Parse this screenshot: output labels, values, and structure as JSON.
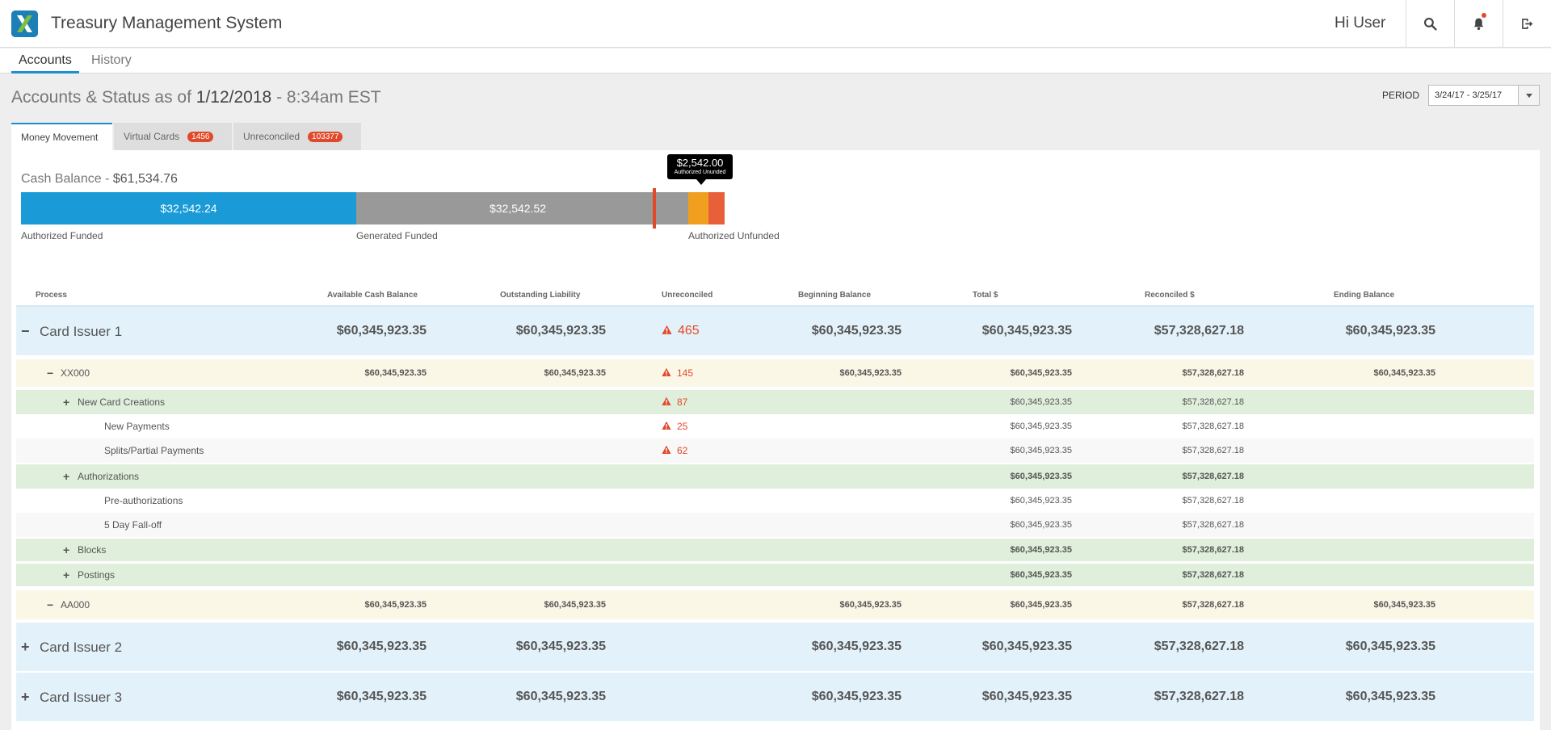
{
  "app": {
    "title": "Treasury Management System",
    "greeting": "Hi User"
  },
  "header_icons": [
    "search-icon",
    "bell-icon",
    "logout-icon"
  ],
  "page_tabs": [
    {
      "label": "Accounts",
      "active": true
    },
    {
      "label": "History",
      "active": false
    }
  ],
  "heading": {
    "prefix": "Accounts & Status as of ",
    "date": "1/12/2018",
    "suffix": " - 8:34am EST"
  },
  "period": {
    "label": "PERIOD",
    "value": "3/24/17 - 3/25/17"
  },
  "sub_tabs": [
    {
      "label": "Money Movement",
      "badge": null,
      "active": true
    },
    {
      "label": "Virtual Cards",
      "badge": "1456",
      "active": false
    },
    {
      "label": "Unreconciled",
      "badge": "103377",
      "active": false
    }
  ],
  "cash": {
    "title": "Cash Balance - ",
    "amount": "$61,534.76",
    "segments": [
      {
        "label": "$32,542.24",
        "caption": "Authorized Funded",
        "color": "#1a9ad6"
      },
      {
        "label": "$32,542.52",
        "caption": "Generated Funded",
        "color": "#999999"
      },
      {
        "label": "",
        "caption": "Authorized Unfunded",
        "color": "#f0a01e"
      },
      {
        "label": "",
        "caption": "",
        "color": "#e8603a"
      }
    ],
    "tooltip": {
      "amount": "$2,542.00",
      "label": "Authorized Ununded"
    }
  },
  "columns": [
    "Process",
    "Available Cash Balance",
    "Outstanding Liability",
    "Unreconciled",
    "Beginning Balance",
    "Total $",
    "Reconciled $",
    "Ending Balance"
  ],
  "rows": [
    {
      "type": "issuer",
      "sign": "−",
      "name": "Card Issuer 1",
      "available": "$60,345,923.35",
      "outstanding": "$60,345,923.35",
      "unrec": "465",
      "beginning": "$60,345,923.35",
      "total": "$60,345,923.35",
      "reconciled": "$57,328,627.18",
      "ending": "$60,345,923.35"
    },
    {
      "type": "acct",
      "sign": "−",
      "name": "XX000",
      "available": "$60,345,923.35",
      "outstanding": "$60,345,923.35",
      "unrec": "145",
      "beginning": "$60,345,923.35",
      "total": "$60,345,923.35",
      "reconciled": "$57,328,627.18",
      "ending": "$60,345,923.35"
    },
    {
      "type": "group",
      "sign": "+",
      "name": "New Card Creations",
      "unrec": "87",
      "total": "$60,345,923.35",
      "reconciled": "$57,328,627.18"
    },
    {
      "type": "leaf",
      "name": "New Payments",
      "unrec": "25",
      "total": "$60,345,923.35",
      "reconciled": "$57,328,627.18"
    },
    {
      "type": "leaf",
      "name": "Splits/Partial Payments",
      "unrec": "62",
      "total": "$60,345,923.35",
      "reconciled": "$57,328,627.18"
    },
    {
      "type": "group",
      "sign": "+",
      "name": "Authorizations",
      "total": "$60,345,923.35",
      "reconciled": "$57,328,627.18"
    },
    {
      "type": "leaf",
      "name": "Pre-authorizations",
      "total": "$60,345,923.35",
      "reconciled": "$57,328,627.18"
    },
    {
      "type": "leaf",
      "name": "5 Day Fall-off",
      "total": "$60,345,923.35",
      "reconciled": "$57,328,627.18"
    },
    {
      "type": "group",
      "sign": "+",
      "name": "Blocks",
      "total": "$60,345,923.35",
      "reconciled": "$57,328,627.18"
    },
    {
      "type": "group",
      "sign": "+",
      "name": "Postings",
      "total": "$60,345,923.35",
      "reconciled": "$57,328,627.18"
    },
    {
      "type": "acct",
      "sign": "−",
      "name": "AA000",
      "available": "$60,345,923.35",
      "outstanding": "$60,345,923.35",
      "beginning": "$60,345,923.35",
      "total": "$60,345,923.35",
      "reconciled": "$57,328,627.18",
      "ending": "$60,345,923.35"
    },
    {
      "type": "issuer",
      "sign": "+",
      "name": "Card Issuer 2",
      "available": "$60,345,923.35",
      "outstanding": "$60,345,923.35",
      "beginning": "$60,345,923.35",
      "total": "$60,345,923.35",
      "reconciled": "$57,328,627.18",
      "ending": "$60,345,923.35"
    },
    {
      "type": "issuer",
      "sign": "+",
      "name": "Card Issuer 3",
      "available": "$60,345,923.35",
      "outstanding": "$60,345,923.35",
      "beginning": "$60,345,923.35",
      "total": "$60,345,923.35",
      "reconciled": "$57,328,627.18",
      "ending": "$60,345,923.35"
    }
  ]
}
